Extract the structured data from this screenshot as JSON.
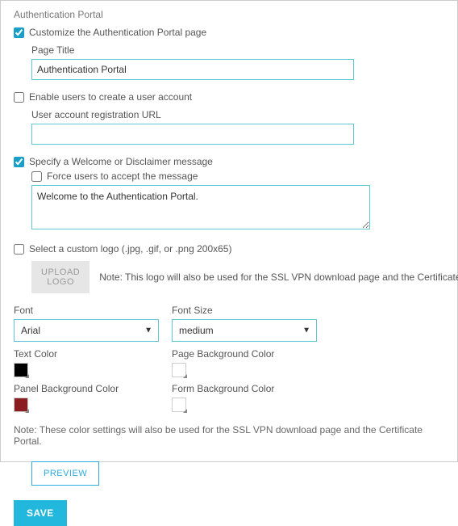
{
  "panel": {
    "title": "Authentication Portal"
  },
  "customize": {
    "label": "Customize the Authentication Portal page",
    "checked": true,
    "page_title_label": "Page Title",
    "page_title_value": "Authentication Portal"
  },
  "enable_users": {
    "label": "Enable users to create a user account",
    "checked": false,
    "url_label": "User account registration URL",
    "url_value": ""
  },
  "welcome": {
    "label": "Specify a Welcome or Disclaimer message",
    "checked": true,
    "force_label": "Force users to accept the message",
    "force_checked": false,
    "message": "Welcome to the Authentication Portal."
  },
  "logo": {
    "label": "Select a custom logo (.jpg, .gif, or .png 200x65)",
    "checked": false,
    "upload_label": "UPLOAD LOGO",
    "note": "Note: This logo will also be used for the SSL VPN download page and the Certificate Portal."
  },
  "font": {
    "label": "Font",
    "value": "Arial",
    "size_label": "Font Size",
    "size_value": "medium"
  },
  "colors": {
    "text_label": "Text Color",
    "text_value": "#000000",
    "page_bg_label": "Page Background Color",
    "page_bg_value": "#ffffff",
    "panel_bg_label": "Panel Background Color",
    "panel_bg_value": "#8a1e1e",
    "form_bg_label": "Form Background Color",
    "form_bg_value": "#ffffff"
  },
  "color_note": "Note: These color settings will also be used for the SSL VPN download page and the Certificate Portal.",
  "buttons": {
    "preview": "PREVIEW",
    "save": "SAVE"
  }
}
